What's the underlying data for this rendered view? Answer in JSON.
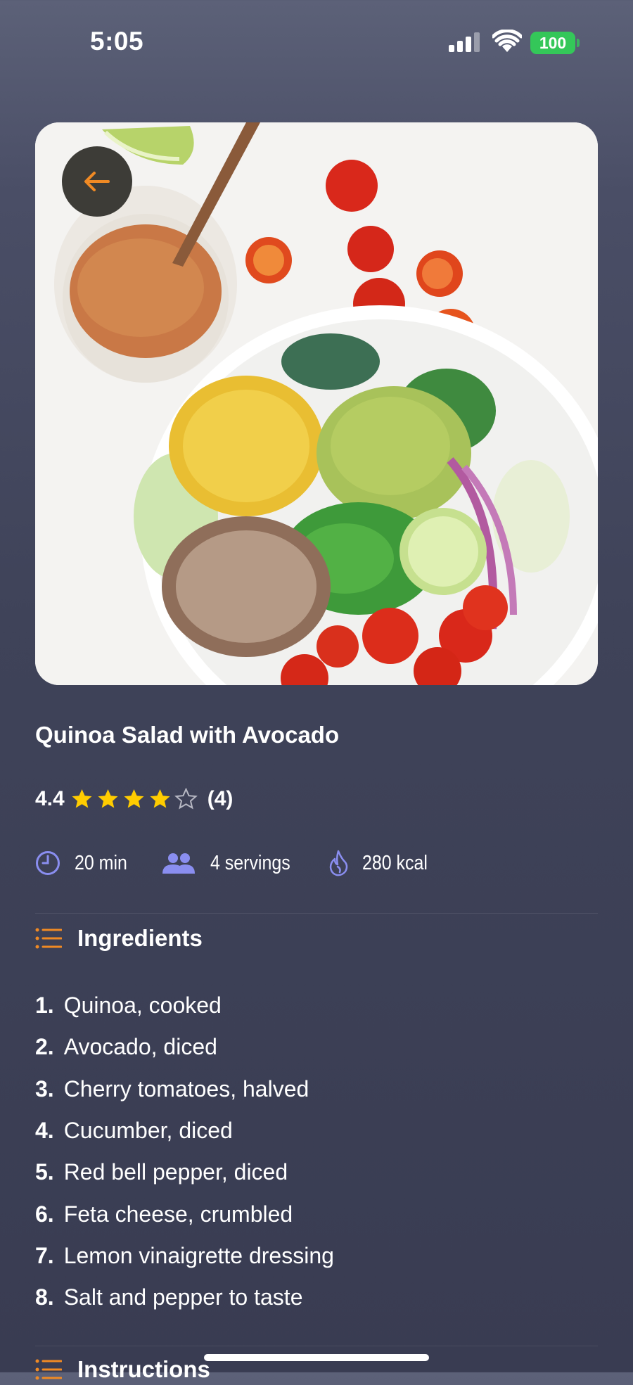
{
  "status_bar": {
    "time": "5:05",
    "battery": "100"
  },
  "recipe": {
    "title": "Quinoa Salad with Avocado",
    "rating": "4.4",
    "stars_filled": 4,
    "stars_total": 5,
    "review_count": "(4)",
    "time": "20 min",
    "servings": "4 servings",
    "calories": "280 kcal"
  },
  "sections": {
    "ingredients_title": "Ingredients",
    "instructions_title": "Instructions"
  },
  "ingredients": [
    {
      "num": "1.",
      "text": "Quinoa, cooked"
    },
    {
      "num": "2.",
      "text": "Avocado, diced"
    },
    {
      "num": "3.",
      "text": "Cherry tomatoes, halved"
    },
    {
      "num": "4.",
      "text": "Cucumber, diced"
    },
    {
      "num": "5.",
      "text": "Red bell pepper, diced"
    },
    {
      "num": "6.",
      "text": "Feta cheese, crumbled"
    },
    {
      "num": "7.",
      "text": "Lemon vinaigrette dressing"
    },
    {
      "num": "8.",
      "text": "Salt and pepper to taste"
    }
  ],
  "colors": {
    "accent": "#f08a24",
    "icon_meta": "#8a8ef0",
    "star": "#ffcc00",
    "battery": "#34c759"
  },
  "icons": {
    "back": "arrow-left-icon",
    "time": "clock-icon",
    "servings": "people-icon",
    "calories": "flame-icon",
    "section": "list-icon"
  }
}
